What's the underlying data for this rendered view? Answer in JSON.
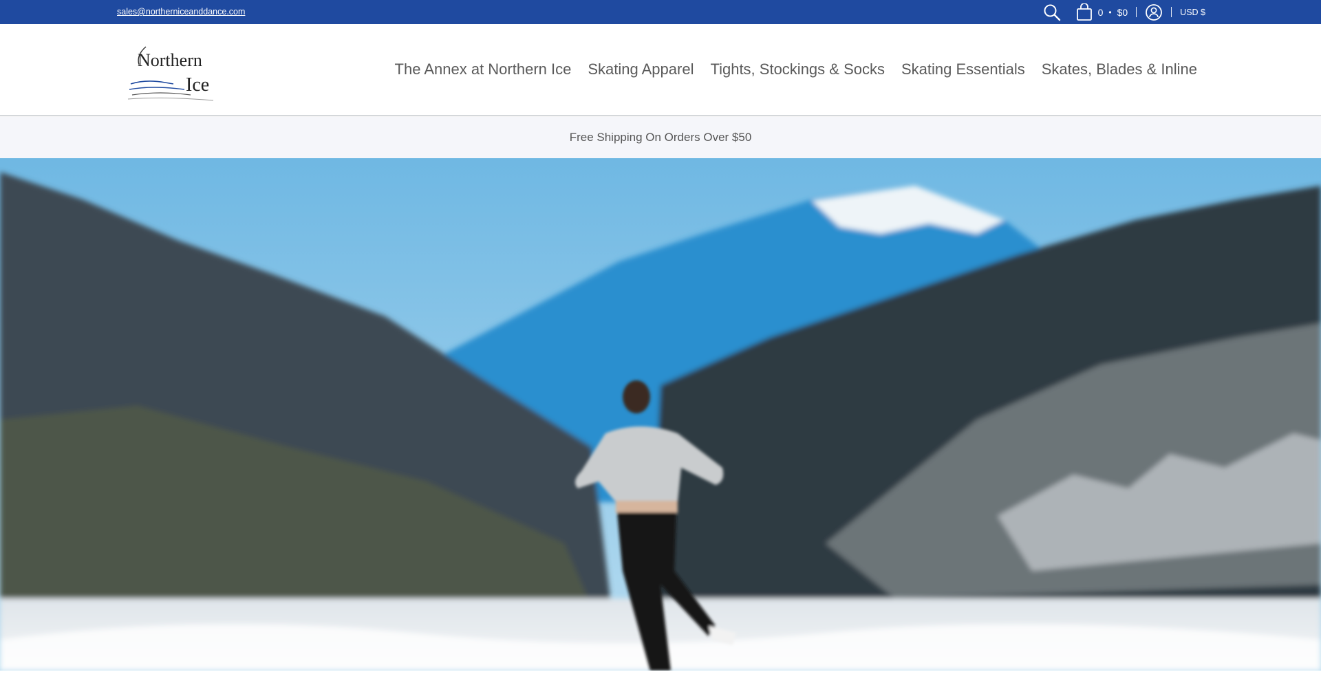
{
  "topbar": {
    "email": "sales@northerniceanddance.com",
    "cart_count": "0",
    "cart_separator": "•",
    "cart_total": "$0",
    "currency": "USD $",
    "icons": [
      "search-icon",
      "cart-bag-icon",
      "account-icon"
    ]
  },
  "header": {
    "logo_text_line1": "Northern",
    "logo_text_line2": "Ice",
    "nav": [
      {
        "label": "The Annex at Northern Ice"
      },
      {
        "label": "Skating Apparel"
      },
      {
        "label": "Tights, Stockings & Socks"
      },
      {
        "label": "Skating Essentials"
      },
      {
        "label": "Skates, Blades & Inline"
      }
    ]
  },
  "announcement": {
    "text": "Free Shipping On Orders Over $50"
  },
  "hero": {
    "image": "figure-skater-on-frozen-lake-with-mountains"
  },
  "colors": {
    "topbar_bg": "#1f4aa0",
    "announce_bg": "#f5f6fa",
    "nav_text": "#5a5a5a"
  }
}
